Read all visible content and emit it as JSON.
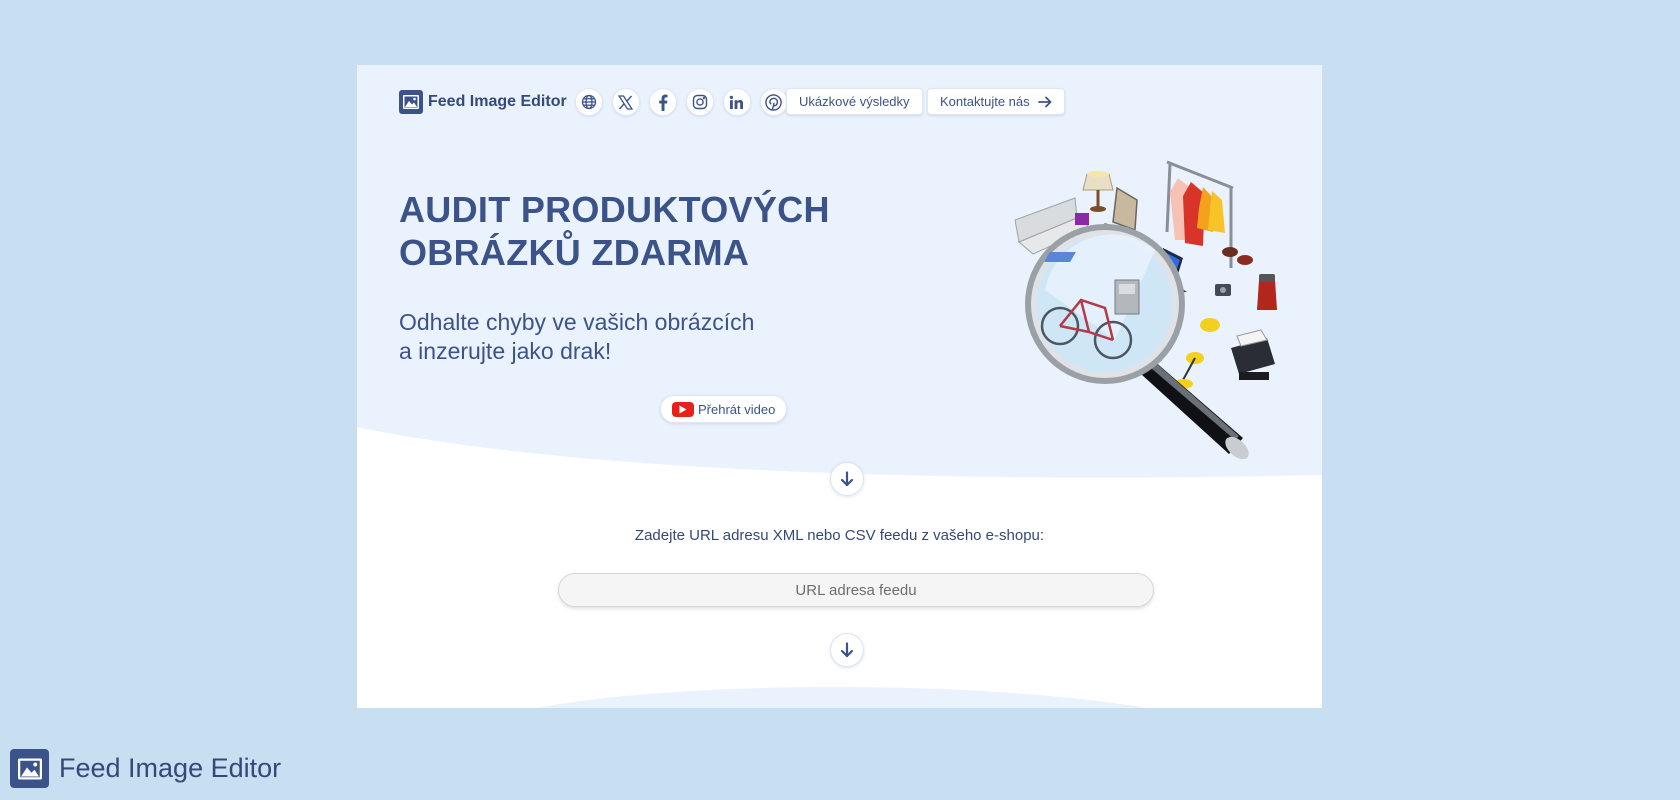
{
  "brand": {
    "name": "Feed Image Editor",
    "icon": "image-icon"
  },
  "nav": {
    "social": [
      {
        "name": "web",
        "icon": "globe-icon"
      },
      {
        "name": "x",
        "icon": "x-icon"
      },
      {
        "name": "facebook",
        "icon": "facebook-icon"
      },
      {
        "name": "instagram",
        "icon": "instagram-icon"
      },
      {
        "name": "linkedin",
        "icon": "linkedin-icon"
      },
      {
        "name": "pinterest",
        "icon": "pinterest-icon"
      }
    ],
    "examples_label": "Ukázkové výsledky",
    "contact_label": "Kontaktujte nás"
  },
  "hero": {
    "title_bold_1": "AUDIT",
    "title_regular_1": "PRODUKTOVÝCH",
    "title_regular_2": "OBRÁZKŮ",
    "title_bold_2": "ZDARMA",
    "subtitle_line1": "Odhalte chyby ve vašich obrázcích",
    "subtitle_line2": "a inzerujte jako drak!",
    "video_label": "Přehrát video"
  },
  "form": {
    "prompt": "Zadejte URL adresu XML nebo CSV feedu z vašeho e-shopu:",
    "url_placeholder": "URL adresa feedu"
  },
  "footer": {
    "brand_name": "Feed Image Editor"
  },
  "colors": {
    "page_bg": "#c7dff0",
    "card_bg": "#eaf2fd",
    "brand": "#3b5389",
    "youtube": "#e62117"
  }
}
